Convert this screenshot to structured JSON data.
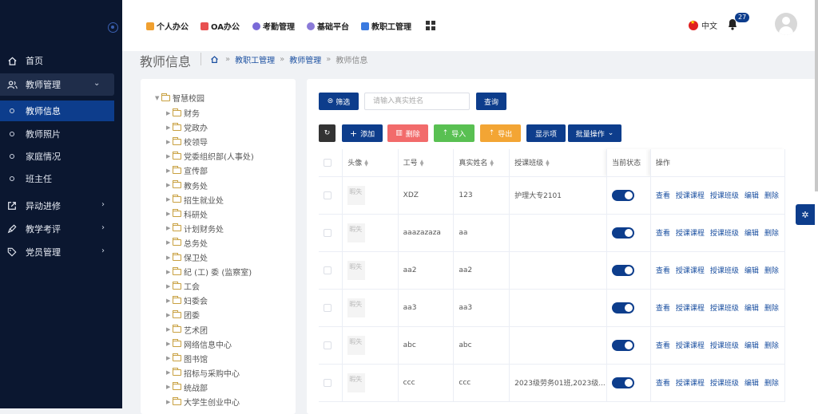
{
  "sidebar": {
    "items": [
      {
        "label": "首页",
        "icon": "home-icon"
      },
      {
        "label": "教师管理",
        "icon": "users-icon",
        "expanded": true
      },
      {
        "label": "异动进修",
        "icon": "external-link-icon"
      },
      {
        "label": "教学考评",
        "icon": "pen-icon"
      },
      {
        "label": "党员管理",
        "icon": "tag-icon"
      }
    ],
    "sub_items": [
      {
        "label": "教师信息",
        "active": true
      },
      {
        "label": "教师照片"
      },
      {
        "label": "家庭情况"
      },
      {
        "label": "班主任"
      }
    ]
  },
  "topnav": {
    "items": [
      {
        "label": "个人办公",
        "color": "#f0a030"
      },
      {
        "label": "OA办公",
        "color": "#e85050"
      },
      {
        "label": "考勤管理",
        "color": "#7a6ad8"
      },
      {
        "label": "基础平台",
        "color": "#8a7ad8"
      },
      {
        "label": "教职工管理",
        "color": "#3a7ae0"
      }
    ],
    "language": "中文",
    "notification_count": "27"
  },
  "page": {
    "title": "教师信息",
    "breadcrumb": [
      "教职工管理",
      "教师管理",
      "教师信息"
    ]
  },
  "tree": {
    "root": "智慧校园",
    "nodes": [
      "财务",
      "党政办",
      "校领导",
      "党委组织部(人事处)",
      "宣传部",
      "教务处",
      "招生就业处",
      "科研处",
      "计划财务处",
      "总务处",
      "保卫处",
      "纪 (工) 委 (监察室)",
      "工会",
      "妇委会",
      "团委",
      "艺术团",
      "网络信息中心",
      "图书馆",
      "招标与采购中心",
      "统战部",
      "大学生创业中心"
    ]
  },
  "toolbar": {
    "filter_label": "筛选",
    "search_placeholder": "请输入真实姓名",
    "query_label": "查询",
    "refresh_icon": "refresh-icon",
    "add_label": "添加",
    "delete_label": "删除",
    "import_label": "导入",
    "export_label": "导出",
    "show_label": "显示项",
    "batch_label": "批量操作"
  },
  "table": {
    "headers": [
      "头像",
      "工号",
      "真实姓名",
      "授课班级",
      "当前状态",
      "操作"
    ],
    "placeholder_img": "暇失",
    "actions": [
      "查看",
      "授课课程",
      "授课班级",
      "编辑",
      "删除"
    ],
    "rows": [
      {
        "id": "XDZ",
        "name": "123",
        "classes": "护理大专2101",
        "status": true
      },
      {
        "id": "aaazazaza",
        "name": "aa",
        "classes": "",
        "status": true
      },
      {
        "id": "aa2",
        "name": "aa2",
        "classes": "",
        "status": true
      },
      {
        "id": "aa3",
        "name": "aa3",
        "classes": "",
        "status": true
      },
      {
        "id": "abc",
        "name": "abc",
        "classes": "",
        "status": true
      },
      {
        "id": "ccc",
        "name": "ccc",
        "classes": "2023级劳务01班,2023级...",
        "status": true
      }
    ]
  }
}
